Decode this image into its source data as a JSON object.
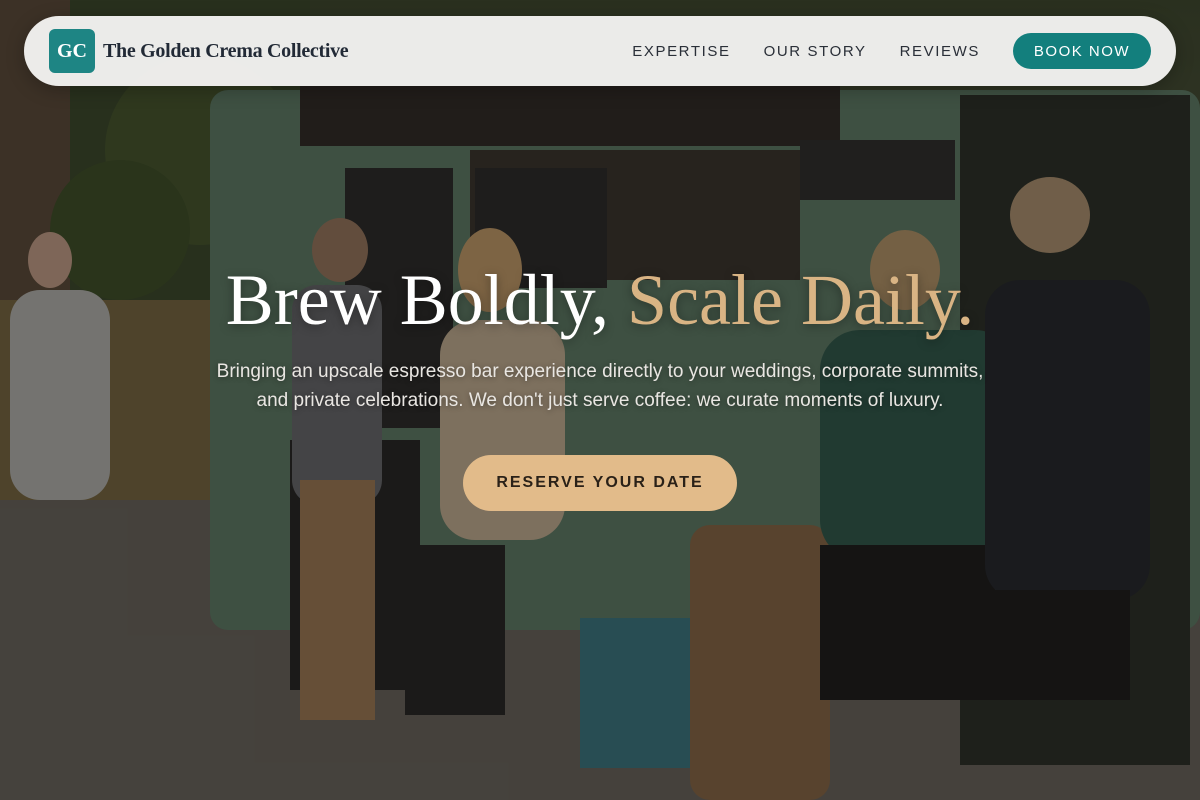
{
  "brand": {
    "initials": "GC",
    "name": "The Golden Crema Collective"
  },
  "nav": {
    "links": [
      {
        "label": "EXPERTISE"
      },
      {
        "label": "OUR STORY"
      },
      {
        "label": "REVIEWS"
      }
    ],
    "book_label": "BOOK NOW"
  },
  "hero": {
    "headline_main": "Brew Boldly,",
    "headline_accent": "Scale Daily.",
    "subtitle": "Bringing an upscale espresso bar experience directly to your weddings, corporate summits, and private celebrations. We don't just serve coffee: we curate moments of luxury.",
    "cta_label": "RESERVE YOUR DATE"
  },
  "colors": {
    "brand_teal": "#1e8584",
    "accent_gold": "#d9b484",
    "cta_tan": "#e2bb8a"
  }
}
